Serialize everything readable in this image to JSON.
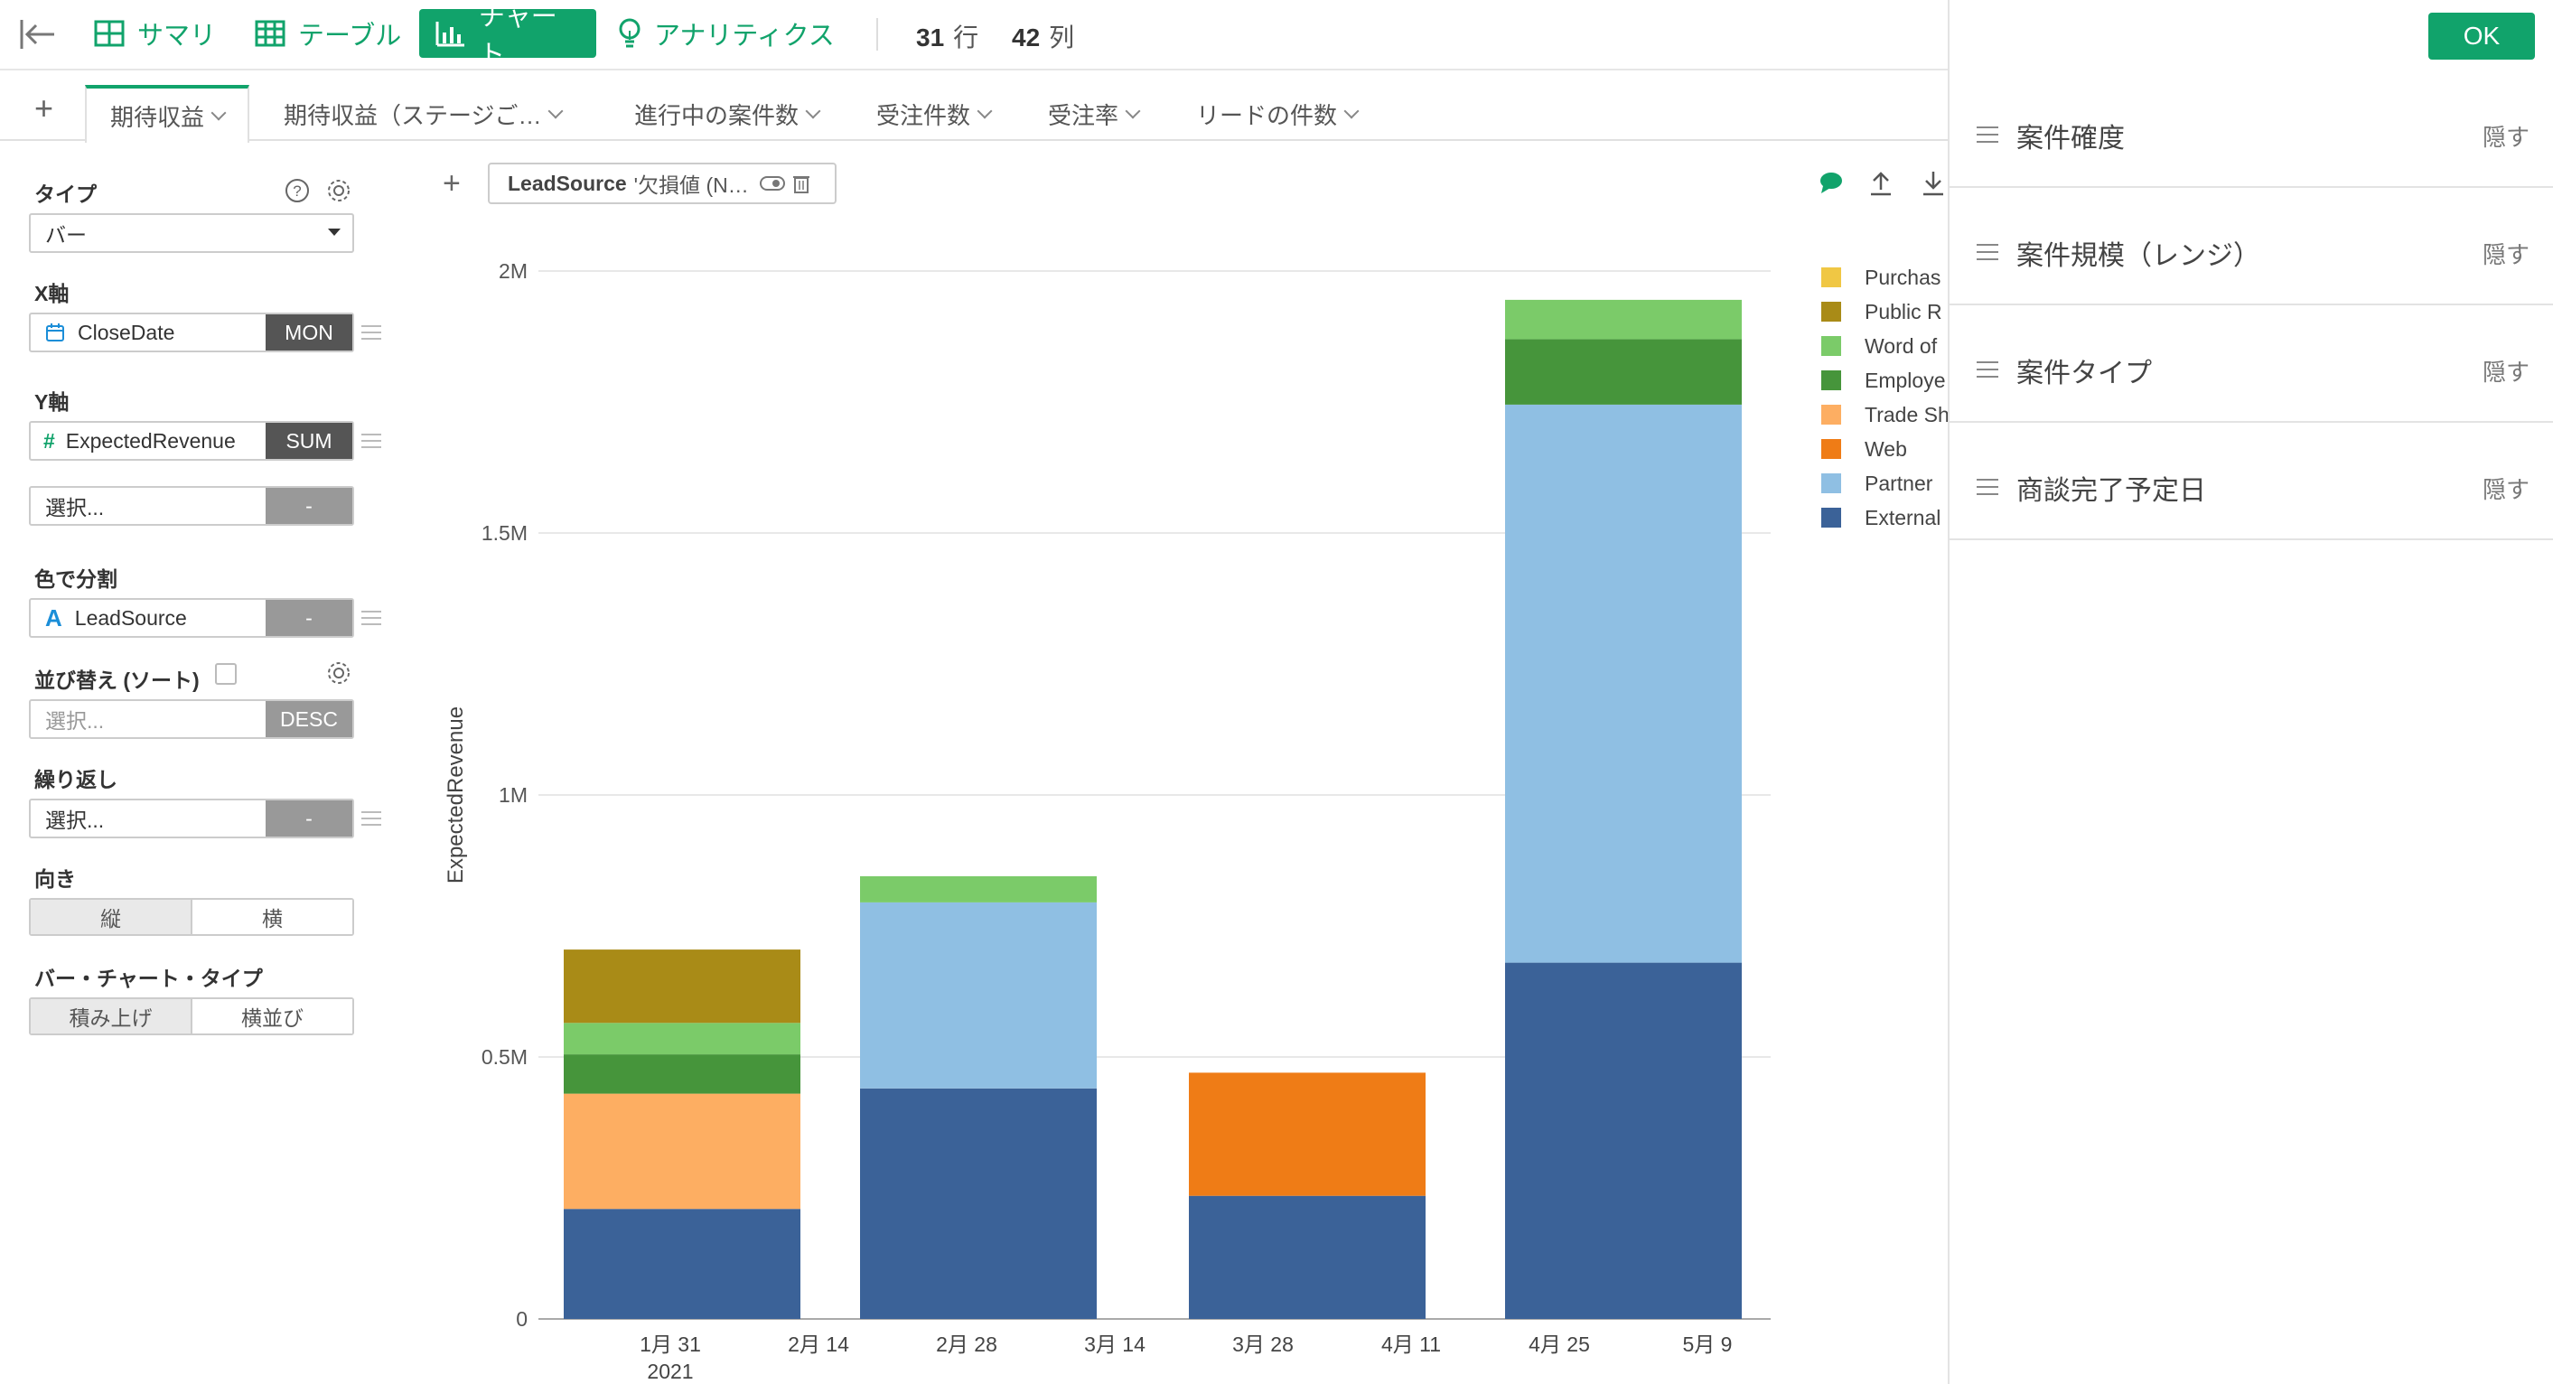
{
  "toolbar": {
    "views": [
      {
        "label": "サマリ",
        "icon": "grid-icon"
      },
      {
        "label": "テーブル",
        "icon": "table-icon"
      },
      {
        "label": "チャート",
        "icon": "bar-chart-icon"
      },
      {
        "label": "アナリティクス",
        "icon": "lightbulb-icon"
      }
    ],
    "rows_count": "31",
    "rows_unit": "行",
    "cols_count": "42",
    "cols_unit": "列"
  },
  "tabs": [
    "期待収益",
    "期待収益（ステージご…",
    "進行中の案件数",
    "受注件数",
    "受注率",
    "リードの件数"
  ],
  "config": {
    "type_label": "タイプ",
    "type_value": "バー",
    "x_label": "X軸",
    "x_field": "CloseDate",
    "x_agg": "MON",
    "y_label": "Y軸",
    "y_field": "ExpectedRevenue",
    "y_agg": "SUM",
    "y2_placeholder": "選択...",
    "y2_agg": "-",
    "color_label": "色で分割",
    "color_field": "LeadSource",
    "color_agg": "-",
    "sort_label": "並び替え (ソート)",
    "sort_placeholder": "選択...",
    "sort_agg": "DESC",
    "repeat_label": "繰り返し",
    "repeat_placeholder": "選択...",
    "repeat_agg": "-",
    "orient_label": "向き",
    "orient_options": [
      "縦",
      "横"
    ],
    "bartype_label": "バー・チャート・タイプ",
    "bartype_options": [
      "積み上げ",
      "横並び"
    ]
  },
  "filter": {
    "field": "LeadSource",
    "text": "'欠損値 (N…"
  },
  "chart_data": {
    "type": "bar",
    "stacked": true,
    "ylabel": "ExpectedRevenue",
    "ylim": [
      0,
      2000000
    ],
    "yticks": [
      "0",
      "0.5M",
      "1M",
      "1.5M",
      "2M"
    ],
    "xticks": [
      "1月 31",
      "2月 14",
      "2月 28",
      "3月 14",
      "3月 28",
      "4月 11",
      "4月 25",
      "5月 9"
    ],
    "xtick_sub": "2021",
    "categories": [
      "2021-01",
      "2021-02",
      "2021-03",
      "2021-04"
    ],
    "series": [
      {
        "name": "External",
        "color": "#3b6298",
        "values": [
          210000,
          440000,
          235000,
          680000
        ]
      },
      {
        "name": "Partner",
        "color": "#8fbfe3",
        "values": [
          0,
          355000,
          0,
          1065000
        ]
      },
      {
        "name": "Web",
        "color": "#ef7c16",
        "values": [
          0,
          0,
          235000,
          0
        ]
      },
      {
        "name": "Trade Sh",
        "color": "#fdae62",
        "values": [
          220000,
          0,
          0,
          0
        ]
      },
      {
        "name": "Employe",
        "color": "#46953b",
        "values": [
          75000,
          0,
          0,
          125000
        ]
      },
      {
        "name": "Word of",
        "color": "#7bcb69",
        "values": [
          60000,
          50000,
          0,
          75000
        ]
      },
      {
        "name": "Public R",
        "color": "#a98b17",
        "values": [
          140000,
          0,
          0,
          0
        ]
      },
      {
        "name": "Purchas",
        "color": "#f0c744",
        "values": [
          0,
          0,
          0,
          0
        ]
      }
    ]
  },
  "right_panel": {
    "ok_label": "OK",
    "rows": [
      {
        "title": "案件確度",
        "action": "隠す"
      },
      {
        "title": "案件規模（レンジ）",
        "action": "隠す"
      },
      {
        "title": "案件タイプ",
        "action": "隠す"
      },
      {
        "title": "商談完了予定日",
        "action": "隠す"
      }
    ]
  }
}
